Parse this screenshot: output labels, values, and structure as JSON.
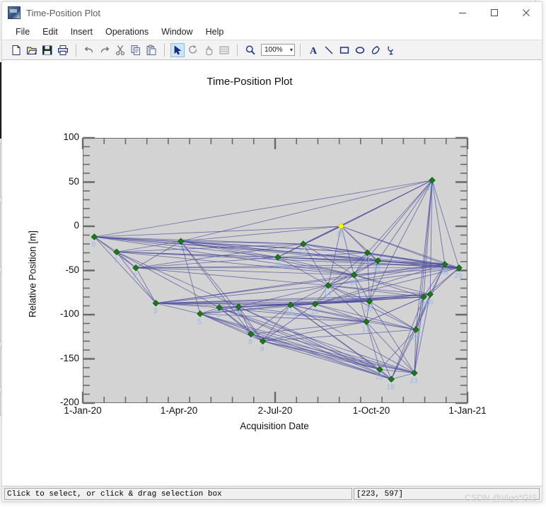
{
  "window": {
    "title": "Time-Position Plot",
    "icon": "app-icon",
    "minimize_label": "–",
    "maximize_label": "□",
    "close_label": "✕"
  },
  "menubar": {
    "items": [
      {
        "label": "File"
      },
      {
        "label": "Edit"
      },
      {
        "label": "Insert"
      },
      {
        "label": "Operations"
      },
      {
        "label": "Window"
      },
      {
        "label": "Help"
      }
    ]
  },
  "toolbar": {
    "zoom_value": "100%",
    "buttons": [
      {
        "name": "new-icon",
        "tip": "New"
      },
      {
        "name": "open-icon",
        "tip": "Open"
      },
      {
        "name": "save-icon",
        "tip": "Save"
      },
      {
        "name": "print-icon",
        "tip": "Print"
      },
      {
        "name": "undo-icon",
        "tip": "Undo"
      },
      {
        "name": "redo-icon",
        "tip": "Redo"
      },
      {
        "name": "cut-icon",
        "tip": "Cut"
      },
      {
        "name": "copy-icon",
        "tip": "Copy"
      },
      {
        "name": "paste-icon",
        "tip": "Paste"
      },
      {
        "name": "select-arrow-icon",
        "tip": "Select"
      },
      {
        "name": "rotate-icon",
        "tip": "Rotate"
      },
      {
        "name": "pan-hand-icon",
        "tip": "Pan"
      },
      {
        "name": "grid-icon",
        "tip": "Grid"
      },
      {
        "name": "magnifier-icon",
        "tip": "Zoom"
      },
      {
        "name": "text-tool-icon",
        "tip": "Text"
      },
      {
        "name": "line-tool-icon",
        "tip": "Line"
      },
      {
        "name": "rectangle-tool-icon",
        "tip": "Rectangle"
      },
      {
        "name": "ellipse-tool-icon",
        "tip": "Ellipse"
      },
      {
        "name": "polygon-tool-icon",
        "tip": "Polygon"
      },
      {
        "name": "polyline-tool-icon",
        "tip": "Polyline"
      }
    ]
  },
  "statusbar": {
    "message": "Click to select, or click & drag selection box",
    "coordinates": "[223, 597]"
  },
  "watermark": "CSDN @Vigo*GIS",
  "colors": {
    "plot_background": "#d3d3d3",
    "point_fill": "#1a7a1a",
    "point_selected_fill": "#ffff00",
    "edge_line": "#4f4f9e",
    "label_text": "#8fb8e8",
    "axis": "#6a6a6a"
  },
  "chart_data": {
    "type": "scatter",
    "title": "Time-Position Plot",
    "xlabel": "Acquisition Date",
    "ylabel": "Relative Position [m]",
    "grid": false,
    "legend": null,
    "ylim": [
      -200,
      100
    ],
    "yticks": [
      100,
      50,
      0,
      -50,
      -100,
      -150,
      -200
    ],
    "ytick_minor_step": 10,
    "xlim": [
      "1-Jan-20",
      "1-Jan-21"
    ],
    "xticks": [
      "1-Jan-20",
      "1-Apr-20",
      "2-Jul-20",
      "1-Oct-20",
      "1-Jan-21"
    ],
    "xtick_minor_count": 18,
    "point_label_key": "index",
    "selected_point": 15,
    "points": [
      {
        "label": "0",
        "date": "9-Jan-20",
        "x": 0.03,
        "y": -12
      },
      {
        "label": "1",
        "date": "2-Feb-20",
        "x": 0.088,
        "y": -29
      },
      {
        "label": "2",
        "date": "20-Feb-20",
        "x": 0.138,
        "y": -47
      },
      {
        "label": "3",
        "date": "16-Mar-20",
        "x": 0.19,
        "y": -87
      },
      {
        "label": "4",
        "date": "4-Apr-20",
        "x": 0.255,
        "y": -17
      },
      {
        "label": "5",
        "date": "22-Apr-20",
        "x": 0.305,
        "y": -99
      },
      {
        "label": "6",
        "date": "10-May-20",
        "x": 0.355,
        "y": -92
      },
      {
        "label": "7",
        "date": "28-May-20",
        "x": 0.405,
        "y": -91
      },
      {
        "label": "8",
        "date": "8-Jun-20",
        "x": 0.437,
        "y": -122
      },
      {
        "label": "9",
        "date": "20-Jun-20",
        "x": 0.468,
        "y": -130
      },
      {
        "label": "10",
        "date": "4-Jul-20",
        "x": 0.507,
        "y": -35
      },
      {
        "label": "11",
        "date": "16-Jul-20",
        "x": 0.54,
        "y": -89
      },
      {
        "label": "12",
        "date": "28-Jul-20",
        "x": 0.573,
        "y": -20
      },
      {
        "label": "13",
        "date": "9-Aug-20",
        "x": 0.604,
        "y": -88
      },
      {
        "label": "14",
        "date": "21-Aug-20",
        "x": 0.638,
        "y": -67
      },
      {
        "label": "15",
        "date": "2-Sep-20",
        "x": 0.672,
        "y": 0
      },
      {
        "label": "16",
        "date": "14-Sep-20",
        "x": 0.705,
        "y": -55
      },
      {
        "label": "17",
        "date": "26-Sep-20",
        "x": 0.737,
        "y": -108
      },
      {
        "label": "18",
        "date": "4-Oct-20",
        "x": 0.772,
        "y": -162
      },
      {
        "label": "19",
        "date": "16-Oct-20",
        "x": 0.802,
        "y": -173
      },
      {
        "label": "20",
        "date": "21-Oct-20",
        "x": 0.745,
        "y": -85
      },
      {
        "label": "21",
        "date": "3-Nov-20",
        "x": 0.74,
        "y": -30
      },
      {
        "label": "22",
        "date": "15-Nov-20",
        "x": 0.767,
        "y": -39
      },
      {
        "label": "23",
        "date": "2-Dec-20",
        "x": 0.862,
        "y": -166
      },
      {
        "label": "24",
        "date": "14-Dec-20",
        "x": 0.866,
        "y": -117
      },
      {
        "label": "25",
        "date": "20-Dec-20",
        "x": 0.886,
        "y": -80
      },
      {
        "label": "26",
        "date": "24-Dec-20",
        "x": 0.903,
        "y": -77
      },
      {
        "label": "27",
        "date": "28-Dec-20",
        "x": 0.908,
        "y": 52
      },
      {
        "label": "28",
        "date": "30-Dec-20",
        "x": 0.941,
        "y": -43
      },
      {
        "label": "29",
        "date": "1-Jan-21",
        "x": 0.978,
        "y": -47
      }
    ],
    "edges": [
      [
        0,
        1
      ],
      [
        0,
        2
      ],
      [
        0,
        3
      ],
      [
        0,
        4
      ],
      [
        0,
        10
      ],
      [
        0,
        12
      ],
      [
        0,
        15
      ],
      [
        0,
        16
      ],
      [
        0,
        21
      ],
      [
        0,
        27
      ],
      [
        0,
        28
      ],
      [
        0,
        29
      ],
      [
        1,
        2
      ],
      [
        1,
        3
      ],
      [
        1,
        4
      ],
      [
        1,
        6
      ],
      [
        1,
        7
      ],
      [
        1,
        10
      ],
      [
        1,
        12
      ],
      [
        1,
        16
      ],
      [
        1,
        22
      ],
      [
        1,
        29
      ],
      [
        2,
        3
      ],
      [
        2,
        4
      ],
      [
        2,
        10
      ],
      [
        2,
        12
      ],
      [
        2,
        14
      ],
      [
        2,
        16
      ],
      [
        2,
        28
      ],
      [
        2,
        29
      ],
      [
        3,
        5
      ],
      [
        3,
        6
      ],
      [
        3,
        7
      ],
      [
        3,
        11
      ],
      [
        3,
        13
      ],
      [
        3,
        14
      ],
      [
        3,
        16
      ],
      [
        3,
        20
      ],
      [
        3,
        25
      ],
      [
        3,
        26
      ],
      [
        3,
        28
      ],
      [
        4,
        5
      ],
      [
        4,
        8
      ],
      [
        4,
        9
      ],
      [
        4,
        10
      ],
      [
        4,
        12
      ],
      [
        4,
        15
      ],
      [
        4,
        16
      ],
      [
        4,
        21
      ],
      [
        4,
        22
      ],
      [
        4,
        27
      ],
      [
        4,
        29
      ],
      [
        5,
        6
      ],
      [
        5,
        7
      ],
      [
        5,
        8
      ],
      [
        5,
        9
      ],
      [
        5,
        11
      ],
      [
        5,
        13
      ],
      [
        5,
        17
      ],
      [
        5,
        18
      ],
      [
        5,
        19
      ],
      [
        5,
        23
      ],
      [
        6,
        7
      ],
      [
        6,
        8
      ],
      [
        6,
        9
      ],
      [
        6,
        11
      ],
      [
        6,
        13
      ],
      [
        6,
        17
      ],
      [
        6,
        18
      ],
      [
        6,
        19
      ],
      [
        6,
        20
      ],
      [
        6,
        23
      ],
      [
        7,
        8
      ],
      [
        7,
        9
      ],
      [
        7,
        11
      ],
      [
        7,
        13
      ],
      [
        7,
        14
      ],
      [
        7,
        17
      ],
      [
        7,
        18
      ],
      [
        7,
        19
      ],
      [
        7,
        20
      ],
      [
        7,
        25
      ],
      [
        7,
        26
      ],
      [
        8,
        9
      ],
      [
        8,
        11
      ],
      [
        8,
        17
      ],
      [
        8,
        18
      ],
      [
        8,
        19
      ],
      [
        8,
        23
      ],
      [
        9,
        11
      ],
      [
        9,
        13
      ],
      [
        9,
        17
      ],
      [
        9,
        18
      ],
      [
        9,
        19
      ],
      [
        9,
        23
      ],
      [
        9,
        24
      ],
      [
        10,
        12
      ],
      [
        10,
        14
      ],
      [
        10,
        15
      ],
      [
        10,
        16
      ],
      [
        10,
        21
      ],
      [
        10,
        22
      ],
      [
        10,
        27
      ],
      [
        10,
        28
      ],
      [
        10,
        29
      ],
      [
        11,
        13
      ],
      [
        11,
        14
      ],
      [
        11,
        17
      ],
      [
        11,
        18
      ],
      [
        11,
        19
      ],
      [
        11,
        20
      ],
      [
        11,
        23
      ],
      [
        11,
        24
      ],
      [
        11,
        25
      ],
      [
        11,
        26
      ],
      [
        12,
        14
      ],
      [
        12,
        15
      ],
      [
        12,
        16
      ],
      [
        12,
        21
      ],
      [
        12,
        22
      ],
      [
        12,
        27
      ],
      [
        12,
        28
      ],
      [
        12,
        29
      ],
      [
        13,
        14
      ],
      [
        13,
        16
      ],
      [
        13,
        17
      ],
      [
        13,
        20
      ],
      [
        13,
        24
      ],
      [
        13,
        25
      ],
      [
        13,
        26
      ],
      [
        13,
        28
      ],
      [
        13,
        29
      ],
      [
        14,
        15
      ],
      [
        14,
        16
      ],
      [
        14,
        17
      ],
      [
        14,
        20
      ],
      [
        14,
        21
      ],
      [
        14,
        22
      ],
      [
        14,
        24
      ],
      [
        14,
        25
      ],
      [
        14,
        26
      ],
      [
        14,
        28
      ],
      [
        14,
        29
      ],
      [
        15,
        16
      ],
      [
        15,
        21
      ],
      [
        15,
        22
      ],
      [
        15,
        27
      ],
      [
        15,
        28
      ],
      [
        15,
        29
      ],
      [
        16,
        17
      ],
      [
        16,
        20
      ],
      [
        16,
        21
      ],
      [
        16,
        22
      ],
      [
        16,
        25
      ],
      [
        16,
        26
      ],
      [
        16,
        27
      ],
      [
        16,
        28
      ],
      [
        16,
        29
      ],
      [
        17,
        18
      ],
      [
        17,
        19
      ],
      [
        17,
        20
      ],
      [
        17,
        23
      ],
      [
        17,
        24
      ],
      [
        17,
        25
      ],
      [
        17,
        26
      ],
      [
        18,
        19
      ],
      [
        18,
        23
      ],
      [
        18,
        24
      ],
      [
        19,
        23
      ],
      [
        19,
        24
      ],
      [
        19,
        25
      ],
      [
        19,
        26
      ],
      [
        20,
        21
      ],
      [
        20,
        22
      ],
      [
        20,
        23
      ],
      [
        20,
        24
      ],
      [
        20,
        27
      ],
      [
        21,
        22
      ],
      [
        21,
        27
      ],
      [
        21,
        28
      ],
      [
        21,
        29
      ],
      [
        22,
        27
      ],
      [
        22,
        28
      ],
      [
        22,
        29
      ],
      [
        23,
        24
      ],
      [
        23,
        25
      ],
      [
        23,
        26
      ],
      [
        23,
        27
      ],
      [
        24,
        25
      ],
      [
        24,
        26
      ],
      [
        24,
        27
      ],
      [
        24,
        28
      ],
      [
        25,
        26
      ],
      [
        25,
        27
      ],
      [
        25,
        28
      ],
      [
        25,
        29
      ],
      [
        26,
        27
      ],
      [
        26,
        28
      ],
      [
        26,
        29
      ],
      [
        27,
        28
      ],
      [
        27,
        29
      ],
      [
        28,
        29
      ]
    ]
  }
}
